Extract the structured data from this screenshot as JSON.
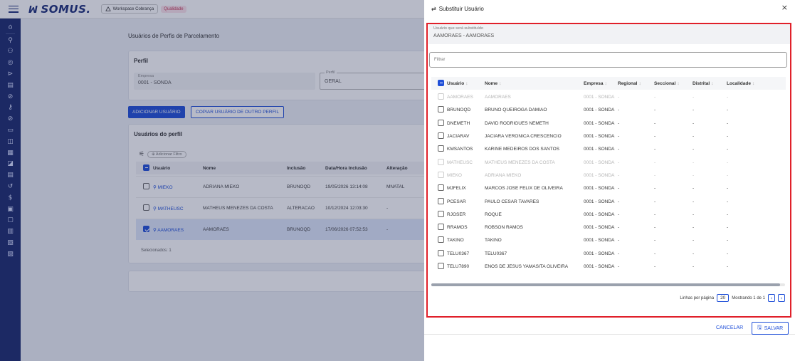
{
  "topbar": {
    "logo": "SOMUS.",
    "workspace": "Workspace Cobrança",
    "badge": "Qualidade"
  },
  "sidebar": {
    "icons": [
      "home-icon",
      "search-icon",
      "users-icon",
      "target-icon",
      "tag-icon",
      "grid-icon",
      "cancel-icon",
      "key-icon",
      "circle-slash-icon",
      "chat-icon",
      "box-icon",
      "calendar-icon",
      "archive-icon",
      "list-icon",
      "history-icon",
      "dollar-icon",
      "calc-icon",
      "doc-icon",
      "bank-icon",
      "report-icon",
      "note-icon"
    ]
  },
  "main": {
    "page_title": "Usuários de Perfis de Parcelamento",
    "perfil_card": {
      "title": "Perfil",
      "empresa_label": "Empresa",
      "empresa_value": "0001 - SONDA",
      "perfil_label": "Perfil",
      "perfil_value": "GERAL"
    },
    "buttons": {
      "add": "ADICIONAR USUÁRIO",
      "copy": "COPIAR USUÁRIO DE OUTRO PERFIL"
    },
    "users_card": {
      "title": "Usuários do perfil",
      "filter_chip": "Adicionar Filtro",
      "columns": [
        "Usuário",
        "Nome",
        "Inclusão",
        "Data/Hora Inclusão",
        "Alteração"
      ],
      "rows": [
        {
          "usuario": "MIEKO",
          "nome": "ADRIANA MIEKO",
          "inclusao": "BRUNOQD",
          "data": "19/05/2026 13:14:08",
          "alteracao": "MNATAL",
          "selected": false
        },
        {
          "usuario": "MATHEUSC",
          "nome": "MATHEUS MENEZES DA COSTA",
          "inclusao": "ALTERACAO",
          "data": "10/12/2024 12:03:30",
          "alteracao": "-",
          "selected": false
        },
        {
          "usuario": "AAMORAES",
          "nome": "AAMORAES",
          "inclusao": "BRUNOQD",
          "data": "17/06/2026 07:52:53",
          "alteracao": "-",
          "selected": true
        }
      ],
      "selected_count": "Selecionados: 1"
    }
  },
  "modal": {
    "title": "Substituir Usuário",
    "subst_label": "Usuário que será substituído",
    "subst_value": "AAMORAES - AAMORAES",
    "filter_placeholder": "Filtrar",
    "columns": [
      "Usuário",
      "Nome",
      "Empresa",
      "Regional",
      "Seccional",
      "Distrital",
      "Localidade"
    ],
    "rows": [
      {
        "usuario": "AAMORAES",
        "nome": "AAMORAES",
        "empresa": "0001 - SONDA",
        "regional": "-",
        "seccional": "-",
        "distrital": "-",
        "localidade": "-",
        "disabled": true
      },
      {
        "usuario": "BRUNOQD",
        "nome": "BRUNO QUEIROGA DAMIAO",
        "empresa": "0001 - SONDA",
        "regional": "-",
        "seccional": "-",
        "distrital": "-",
        "localidade": "-",
        "disabled": false
      },
      {
        "usuario": "DNEMETH",
        "nome": "DAVID RODRIGUES NEMETH",
        "empresa": "0001 - SONDA",
        "regional": "-",
        "seccional": "-",
        "distrital": "-",
        "localidade": "-",
        "disabled": false
      },
      {
        "usuario": "JACIARAV",
        "nome": "JACIARA VERONICA CRESCENCIO",
        "empresa": "0001 - SONDA",
        "regional": "-",
        "seccional": "-",
        "distrital": "-",
        "localidade": "-",
        "disabled": false
      },
      {
        "usuario": "KMSANTOS",
        "nome": "KARINE MEDEIROS DOS SANTOS",
        "empresa": "0001 - SONDA",
        "regional": "-",
        "seccional": "-",
        "distrital": "-",
        "localidade": "-",
        "disabled": false
      },
      {
        "usuario": "MATHEUSC",
        "nome": "MATHEUS MENEZES DA COSTA",
        "empresa": "0001 - SONDA",
        "regional": "-",
        "seccional": "-",
        "distrital": "-",
        "localidade": "-",
        "disabled": true
      },
      {
        "usuario": "MIEKO",
        "nome": "ADRIANA MIEKO",
        "empresa": "0001 - SONDA",
        "regional": "-",
        "seccional": "-",
        "distrital": "-",
        "localidade": "-",
        "disabled": true
      },
      {
        "usuario": "MJFELIX",
        "nome": "MARCOS JOSE FELIX DE OLIVEIRA",
        "empresa": "0001 - SONDA",
        "regional": "-",
        "seccional": "-",
        "distrital": "-",
        "localidade": "-",
        "disabled": false
      },
      {
        "usuario": "PCESAR",
        "nome": "PAULO CESAR TAVARES",
        "empresa": "0001 - SONDA",
        "regional": "-",
        "seccional": "-",
        "distrital": "-",
        "localidade": "-",
        "disabled": false
      },
      {
        "usuario": "RJOSER",
        "nome": "ROQUE",
        "empresa": "0001 - SONDA",
        "regional": "-",
        "seccional": "-",
        "distrital": "-",
        "localidade": "-",
        "disabled": false
      },
      {
        "usuario": "RRAMOS",
        "nome": "ROBSON RAMOS",
        "empresa": "0001 - SONDA",
        "regional": "-",
        "seccional": "-",
        "distrital": "-",
        "localidade": "-",
        "disabled": false
      },
      {
        "usuario": "TAKINO",
        "nome": "TAKINO",
        "empresa": "0001 - SONDA",
        "regional": "-",
        "seccional": "-",
        "distrital": "-",
        "localidade": "-",
        "disabled": false
      },
      {
        "usuario": "TELU0367",
        "nome": "TELU0367",
        "empresa": "0001 - SONDA",
        "regional": "-",
        "seccional": "-",
        "distrital": "-",
        "localidade": "-",
        "disabled": false
      },
      {
        "usuario": "TELU7890",
        "nome": "ENOS DE JESUS YAMASITA OLIVEIRA",
        "empresa": "0001 - SONDA",
        "regional": "-",
        "seccional": "-",
        "distrital": "-",
        "localidade": "-",
        "disabled": false
      }
    ],
    "pager": {
      "rows_label": "Linhas por página",
      "rows_value": "20",
      "showing": "Mostrando 1 de 1"
    },
    "cancel": "CANCELAR",
    "save": "SALVAR",
    "colors": {
      "primary": "#1f4fd8",
      "highlight": "#e0202a",
      "sidebar": "#1b2a6e"
    }
  }
}
